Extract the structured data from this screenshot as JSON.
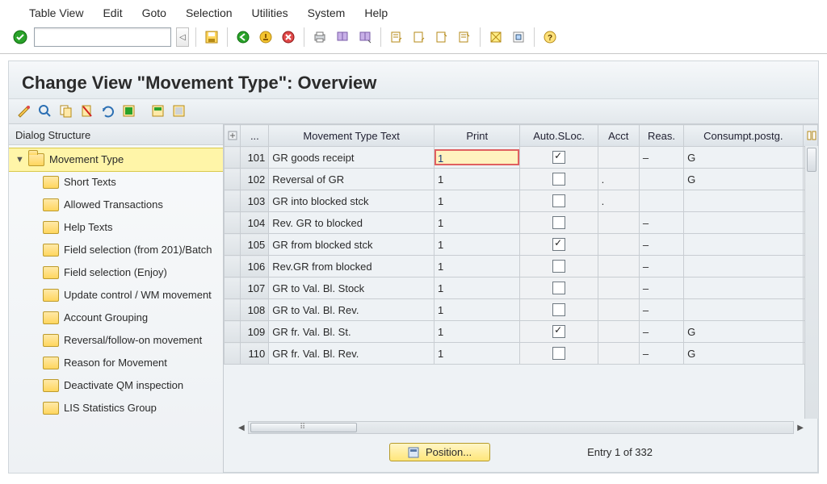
{
  "menu": {
    "items": [
      "Table View",
      "Edit",
      "Goto",
      "Selection",
      "Utilities",
      "System",
      "Help"
    ]
  },
  "toolbar": {
    "icons": [
      "check-circle-icon",
      "save-icon",
      "back-icon",
      "exit-icon",
      "cancel-icon",
      "print-icon",
      "find-icon",
      "find-next-icon",
      "first-page-icon",
      "prev-page-icon",
      "next-page-icon",
      "last-page-icon",
      "new-session-icon",
      "shortcut-icon",
      "help-icon"
    ]
  },
  "page": {
    "title": "Change View \"Movement Type\": Overview"
  },
  "tree": {
    "title": "Dialog Structure",
    "root": "Movement Type",
    "children": [
      "Short Texts",
      "Allowed Transactions",
      "Help Texts",
      "Field selection (from 201)/Batch",
      "Field selection (Enjoy)",
      "Update control / WM movement",
      "Account Grouping",
      "Reversal/follow-on movement",
      "Reason for Movement",
      "Deactivate QM inspection",
      "LIS Statistics Group"
    ]
  },
  "table": {
    "headers": {
      "sel": "",
      "code": "...",
      "mvt_text": "Movement Type Text",
      "print": "Print",
      "auto_sloc": "Auto.SLoc.",
      "acct": "Acct",
      "reas": "Reas.",
      "consumpt": "Consumpt.postg."
    },
    "rows": [
      {
        "code": "101",
        "mvt_text": "GR goods receipt",
        "print": "1",
        "auto_sloc": true,
        "acct": "",
        "reas": "–",
        "consumpt": "G",
        "editing": true
      },
      {
        "code": "102",
        "mvt_text": "Reversal of GR",
        "print": "1",
        "auto_sloc": false,
        "acct": ".",
        "reas": "",
        "consumpt": "G"
      },
      {
        "code": "103",
        "mvt_text": "GR into blocked stck",
        "print": "1",
        "auto_sloc": false,
        "acct": ".",
        "reas": "",
        "consumpt": ""
      },
      {
        "code": "104",
        "mvt_text": "Rev. GR to blocked",
        "print": "1",
        "auto_sloc": false,
        "acct": "",
        "reas": "–",
        "consumpt": ""
      },
      {
        "code": "105",
        "mvt_text": "GR from blocked stck",
        "print": "1",
        "auto_sloc": true,
        "acct": "",
        "reas": "–",
        "consumpt": ""
      },
      {
        "code": "106",
        "mvt_text": "Rev.GR from blocked",
        "print": "1",
        "auto_sloc": false,
        "acct": "",
        "reas": "–",
        "consumpt": ""
      },
      {
        "code": "107",
        "mvt_text": "GR to Val. Bl. Stock",
        "print": "1",
        "auto_sloc": false,
        "acct": "",
        "reas": "–",
        "consumpt": ""
      },
      {
        "code": "108",
        "mvt_text": "GR to Val. Bl. Rev.",
        "print": "1",
        "auto_sloc": false,
        "acct": "",
        "reas": "–",
        "consumpt": ""
      },
      {
        "code": "109",
        "mvt_text": "GR fr. Val. Bl. St.",
        "print": "1",
        "auto_sloc": true,
        "acct": "",
        "reas": "–",
        "consumpt": "G"
      },
      {
        "code": "110",
        "mvt_text": "GR fr. Val. Bl. Rev.",
        "print": "1",
        "auto_sloc": false,
        "acct": "",
        "reas": "–",
        "consumpt": "G"
      }
    ]
  },
  "footer": {
    "position_label": "Position...",
    "entry_label": "Entry 1 of 332"
  }
}
